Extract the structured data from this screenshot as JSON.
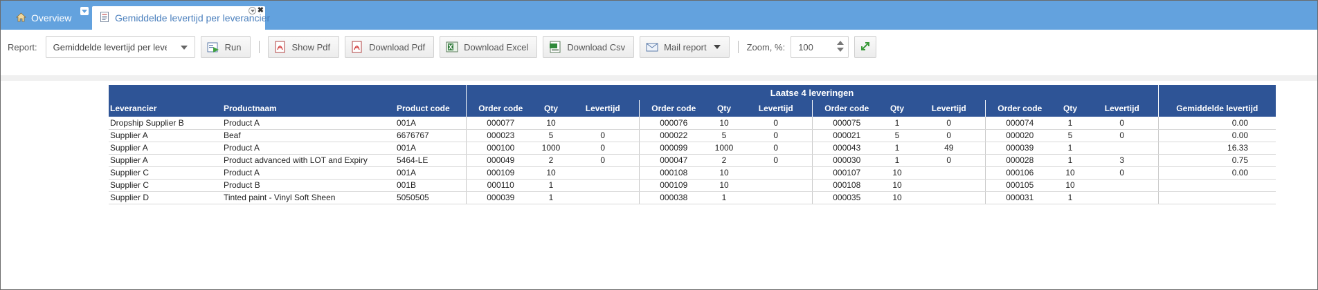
{
  "tabs": [
    {
      "label": "Overview",
      "icon": "home-icon"
    },
    {
      "label": "Gemiddelde levertijd per leverancier",
      "icon": "document-icon"
    }
  ],
  "toolbar": {
    "report_label": "Report:",
    "report_value": "Gemiddelde levertijd per leverancier",
    "run_label": "Run",
    "show_pdf_label": "Show Pdf",
    "download_pdf_label": "Download Pdf",
    "download_excel_label": "Download Excel",
    "download_csv_label": "Download Csv",
    "mail_report_label": "Mail report",
    "zoom_label": "Zoom, %:",
    "zoom_value": "100"
  },
  "report": {
    "group_title": "Laatse 4 leveringen",
    "headers": {
      "supplier": "Leverancier",
      "product_name": "Productnaam",
      "product_code": "Product code",
      "order_code": "Order code",
      "qty": "Qty",
      "leadtime": "Levertijd",
      "avg_leadtime": "Gemiddelde levertijd"
    },
    "rows": [
      {
        "supplier": "Dropship Supplier B",
        "product": "Product A",
        "code": "001A",
        "d1": [
          "000077",
          "10",
          ""
        ],
        "d2": [
          "000076",
          "10",
          "0"
        ],
        "d3": [
          "000075",
          "1",
          "0"
        ],
        "d4": [
          "000074",
          "1",
          "0"
        ],
        "avg": "0.00"
      },
      {
        "supplier": "Supplier A",
        "product": "Beaf",
        "code": "6676767",
        "d1": [
          "000023",
          "5",
          "0"
        ],
        "d2": [
          "000022",
          "5",
          "0"
        ],
        "d3": [
          "000021",
          "5",
          "0"
        ],
        "d4": [
          "000020",
          "5",
          "0"
        ],
        "avg": "0.00"
      },
      {
        "supplier": "Supplier A",
        "product": "Product A",
        "code": "001A",
        "d1": [
          "000100",
          "1000",
          "0"
        ],
        "d2": [
          "000099",
          "1000",
          "0"
        ],
        "d3": [
          "000043",
          "1",
          "49"
        ],
        "d4": [
          "000039",
          "1",
          ""
        ],
        "avg": "16.33"
      },
      {
        "supplier": "Supplier A",
        "product": "Product advanced with LOT and Expiry",
        "code": "5464-LE",
        "d1": [
          "000049",
          "2",
          "0"
        ],
        "d2": [
          "000047",
          "2",
          "0"
        ],
        "d3": [
          "000030",
          "1",
          "0"
        ],
        "d4": [
          "000028",
          "1",
          "3"
        ],
        "avg": "0.75"
      },
      {
        "supplier": "Supplier C",
        "product": "Product A",
        "code": "001A",
        "d1": [
          "000109",
          "10",
          ""
        ],
        "d2": [
          "000108",
          "10",
          ""
        ],
        "d3": [
          "000107",
          "10",
          ""
        ],
        "d4": [
          "000106",
          "10",
          "0"
        ],
        "avg": "0.00"
      },
      {
        "supplier": "Supplier C",
        "product": "Product B",
        "code": "001B",
        "d1": [
          "000110",
          "1",
          ""
        ],
        "d2": [
          "000109",
          "10",
          ""
        ],
        "d3": [
          "000108",
          "10",
          ""
        ],
        "d4": [
          "000105",
          "10",
          ""
        ],
        "avg": ""
      },
      {
        "supplier": "Supplier D",
        "product": "Tinted paint - Vinyl Soft Sheen",
        "code": "5050505",
        "d1": [
          "000039",
          "1",
          ""
        ],
        "d2": [
          "000038",
          "1",
          ""
        ],
        "d3": [
          "000035",
          "10",
          ""
        ],
        "d4": [
          "000031",
          "1",
          ""
        ],
        "avg": ""
      }
    ]
  },
  "colors": {
    "tabbar": "#63a2de",
    "table_header": "#2e5496",
    "active_tab_text": "#4a7fbd"
  }
}
